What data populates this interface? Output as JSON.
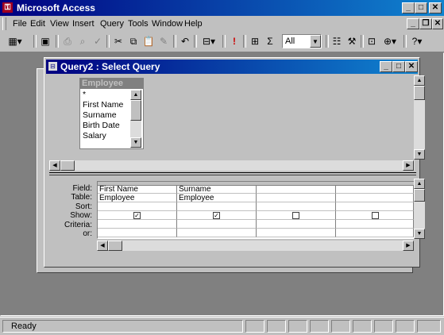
{
  "app": {
    "title": "Microsoft Access"
  },
  "menu": {
    "items": [
      "File",
      "Edit",
      "View",
      "Insert",
      "Query",
      "Tools",
      "Window",
      "Help"
    ]
  },
  "toolbar": {
    "buttons": [
      "datasheet-view-icon",
      "save-icon",
      "print-icon",
      "print-preview-icon",
      "spelling-icon",
      "cut-icon",
      "copy-icon",
      "paste-icon",
      "format-painter-icon",
      "undo-icon",
      "query-type-icon",
      "run-icon",
      "show-table-icon",
      "totals-icon",
      "properties-icon",
      "build-icon",
      "database-window-icon",
      "new-object-icon",
      "help-icon"
    ],
    "top_values": "All",
    "run_color": "#cc0000"
  },
  "query_window": {
    "title": "Query2 : Select Query",
    "table": {
      "name": "Employee",
      "fields": [
        "*",
        "First Name",
        "Surname",
        "Birth Date",
        "Salary"
      ]
    },
    "grid": {
      "row_labels": [
        "Field:",
        "Table:",
        "Sort:",
        "Show:",
        "Criteria:",
        "or:"
      ],
      "columns": [
        {
          "field": "First Name",
          "table": "Employee",
          "sort": "",
          "show": true,
          "criteria": "",
          "or": ""
        },
        {
          "field": "Surname",
          "table": "Employee",
          "sort": "",
          "show": true,
          "criteria": "",
          "or": ""
        },
        {
          "field": "",
          "table": "",
          "sort": "",
          "show": false,
          "criteria": "",
          "or": ""
        },
        {
          "field": "",
          "table": "",
          "sort": "",
          "show": false,
          "criteria": "",
          "or": ""
        }
      ]
    }
  },
  "status": {
    "text": "Ready"
  },
  "colors": {
    "title_bar": "#000080",
    "face": "#c0c0c0",
    "mdi_background": "#808080"
  }
}
